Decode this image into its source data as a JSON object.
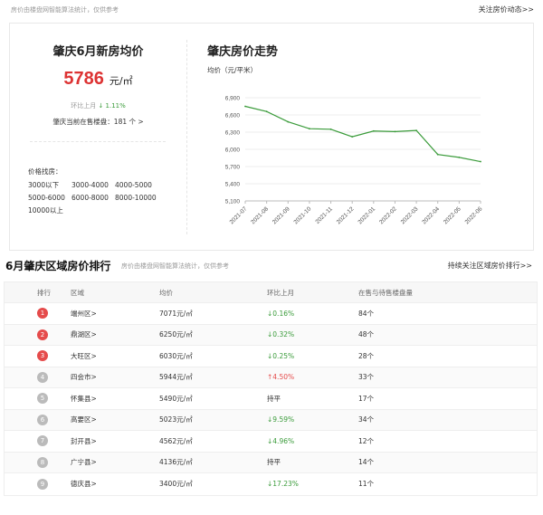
{
  "top": {
    "note": "房价由楼盘网智能算法统计，仅供参考",
    "follow_link": "关注房价动态>>"
  },
  "summary": {
    "title": "肇庆6月新房均价",
    "price": "5786",
    "unit": "元/㎡",
    "mom_label": "环比上月",
    "mom_value": "↓ 1.11%",
    "onsale": "肇庆当前在售楼盘：181 个 >",
    "range_label": "价格找房：",
    "ranges": [
      "3000以下",
      "3000-4000",
      "4000-5000",
      "5000-6000",
      "6000-8000",
      "8000-10000",
      "10000以上"
    ]
  },
  "trend": {
    "title": "肇庆房价走势",
    "unit": "均价（元/平米）"
  },
  "chart_data": {
    "type": "line",
    "title": "肇庆房价走势",
    "ylabel": "均价（元/平米）",
    "xlabel": "",
    "categories": [
      "2021-07",
      "2021-08",
      "2021-09",
      "2021-10",
      "2021-11",
      "2021-12",
      "2022-01",
      "2022-02",
      "2022-03",
      "2022-04",
      "2022-05",
      "2022-06"
    ],
    "values": [
      6750,
      6660,
      6480,
      6360,
      6350,
      6220,
      6320,
      6310,
      6330,
      5910,
      5860,
      5786
    ],
    "ylim": [
      5100,
      6900
    ],
    "yticks": [
      "5,100",
      "5,400",
      "5,700",
      "6,000",
      "6,300",
      "6,600",
      "6,900"
    ],
    "ytick_values": [
      5100,
      5400,
      5700,
      6000,
      6300,
      6600,
      6900
    ],
    "line_color": "#3a9b3a",
    "grid": true
  },
  "ranking": {
    "title": "6月肇庆区域房价排行",
    "note": "房价由楼盘网智能算法统计，仅供参考",
    "follow_link": "持续关注区域房价排行>>",
    "headers": [
      "排行",
      "区域",
      "均价",
      "环比上月",
      "在售与待售楼盘量"
    ],
    "rows": [
      {
        "rank": "1",
        "area": "端州区>",
        "price": "7071元/㎡",
        "mom": "↓0.16%",
        "dir": "down",
        "count": "84个"
      },
      {
        "rank": "2",
        "area": "鼎湖区>",
        "price": "6250元/㎡",
        "mom": "↓0.32%",
        "dir": "down",
        "count": "48个"
      },
      {
        "rank": "3",
        "area": "大旺区>",
        "price": "6030元/㎡",
        "mom": "↓0.25%",
        "dir": "down",
        "count": "28个"
      },
      {
        "rank": "4",
        "area": "四会市>",
        "price": "5944元/㎡",
        "mom": "↑4.50%",
        "dir": "up",
        "count": "33个"
      },
      {
        "rank": "5",
        "area": "怀集县>",
        "price": "5490元/㎡",
        "mom": "持平",
        "dir": "flat",
        "count": "17个"
      },
      {
        "rank": "6",
        "area": "高要区>",
        "price": "5023元/㎡",
        "mom": "↓9.59%",
        "dir": "down",
        "count": "34个"
      },
      {
        "rank": "7",
        "area": "封开县>",
        "price": "4562元/㎡",
        "mom": "↓4.96%",
        "dir": "down",
        "count": "12个"
      },
      {
        "rank": "8",
        "area": "广宁县>",
        "price": "4136元/㎡",
        "mom": "持平",
        "dir": "flat",
        "count": "14个"
      },
      {
        "rank": "9",
        "area": "德庆县>",
        "price": "3400元/㎡",
        "mom": "↓17.23%",
        "dir": "down",
        "count": "11个"
      }
    ]
  }
}
